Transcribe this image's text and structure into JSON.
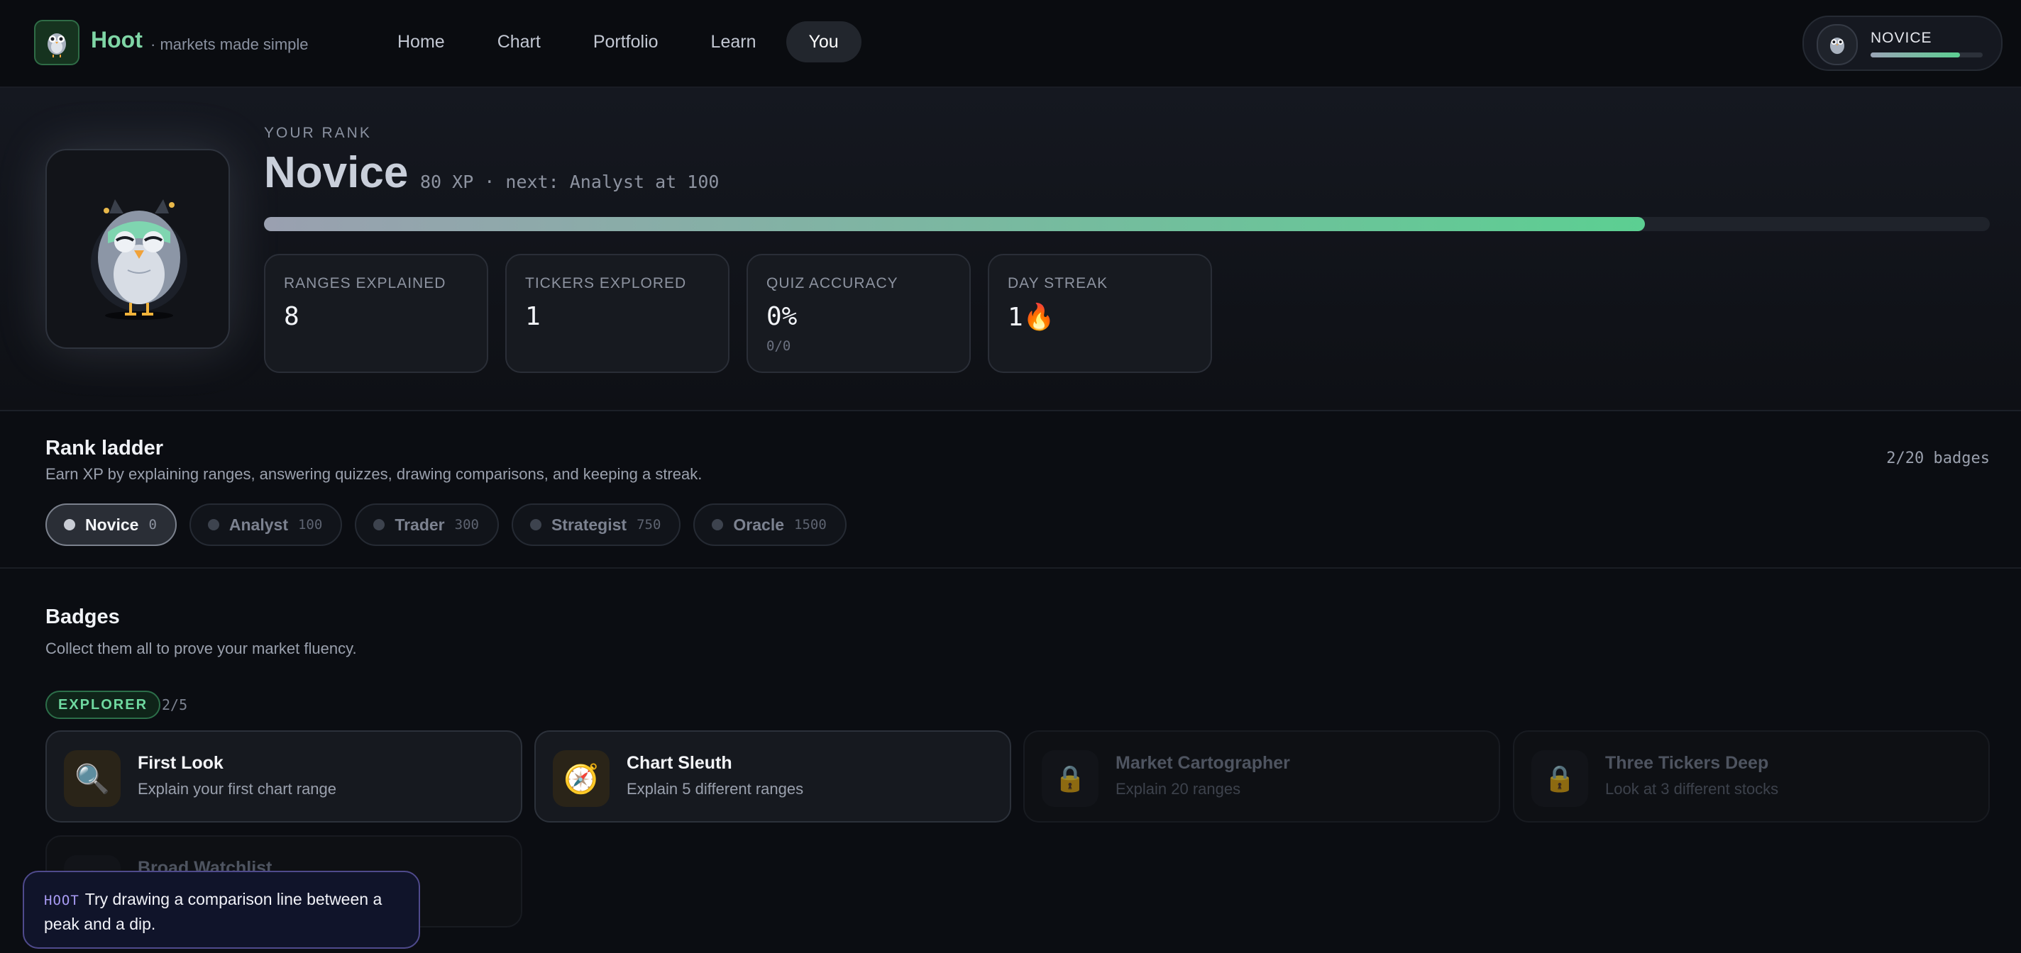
{
  "header": {
    "brand": "Hoot",
    "tagline": "· markets made simple",
    "nav": [
      {
        "label": "Home"
      },
      {
        "label": "Chart"
      },
      {
        "label": "Portfolio"
      },
      {
        "label": "Learn"
      },
      {
        "label": "You",
        "active": true
      }
    ],
    "rank_chip": {
      "label": "NOVICE",
      "progress": 0.8
    }
  },
  "hero": {
    "eyebrow": "YOUR RANK",
    "rank": "Novice",
    "xp_line": "80 XP · next: Analyst at 100",
    "xp_progress": 0.8,
    "stats": [
      {
        "label": "RANGES EXPLAINED",
        "value": "8",
        "sub": ""
      },
      {
        "label": "TICKERS EXPLORED",
        "value": "1",
        "sub": ""
      },
      {
        "label": "QUIZ ACCURACY",
        "value": "0%",
        "sub": "0/0"
      },
      {
        "label": "DAY STREAK",
        "value": "1🔥",
        "sub": ""
      }
    ]
  },
  "ladder": {
    "title": "Rank ladder",
    "subtitle": "Earn XP by explaining ranges, answering quizzes, drawing comparisons, and keeping a streak.",
    "badge_count": "2/20 badges",
    "ranks": [
      {
        "name": "Novice",
        "xp": "0",
        "active": true
      },
      {
        "name": "Analyst",
        "xp": "100"
      },
      {
        "name": "Trader",
        "xp": "300"
      },
      {
        "name": "Strategist",
        "xp": "750"
      },
      {
        "name": "Oracle",
        "xp": "1500"
      }
    ]
  },
  "badges": {
    "title": "Badges",
    "subtitle": "Collect them all to prove your market fluency.",
    "category": {
      "name": "EXPLORER",
      "count": "2/5"
    },
    "items": [
      {
        "name": "First Look",
        "desc": "Explain your first chart range",
        "icon": "🔍",
        "icon_name": "magnifier-icon",
        "locked": false
      },
      {
        "name": "Chart Sleuth",
        "desc": "Explain 5 different ranges",
        "icon": "🧭",
        "icon_name": "compass-icon",
        "locked": false
      },
      {
        "name": "Market Cartographer",
        "desc": "Explain 20 ranges",
        "icon": "🔒",
        "icon_name": "lock-icon",
        "locked": true
      },
      {
        "name": "Three Tickers Deep",
        "desc": "Look at 3 different stocks",
        "icon": "🔒",
        "icon_name": "lock-icon",
        "locked": true
      },
      {
        "name": "Broad Watchlist",
        "desc": "",
        "icon": "🔒",
        "icon_name": "lock-icon",
        "locked": true
      }
    ]
  },
  "toast": {
    "tag": "HOOT",
    "text": "Try drawing a comparison line between a peak and a dip."
  },
  "colors": {
    "accent_green": "#5ccf92",
    "brand_green": "#7fd5a5",
    "toast_border": "#4f4a8c",
    "background": "#0b0d12"
  }
}
